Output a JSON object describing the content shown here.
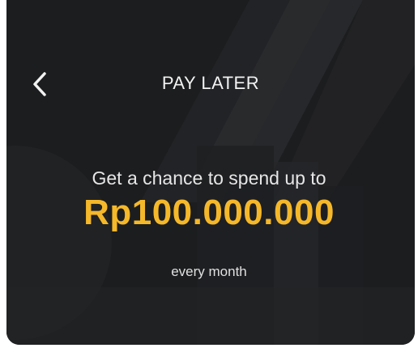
{
  "header": {
    "title": "PAY LATER",
    "back_icon": "chevron-left-icon"
  },
  "promo": {
    "subtitle": "Get a chance to spend up to",
    "amount": "Rp100.000.000",
    "period": "every month"
  },
  "colors": {
    "card_background": "#1c1d1f",
    "accent_amount": "#f5b82a",
    "text_primary": "#f2f2f2"
  }
}
